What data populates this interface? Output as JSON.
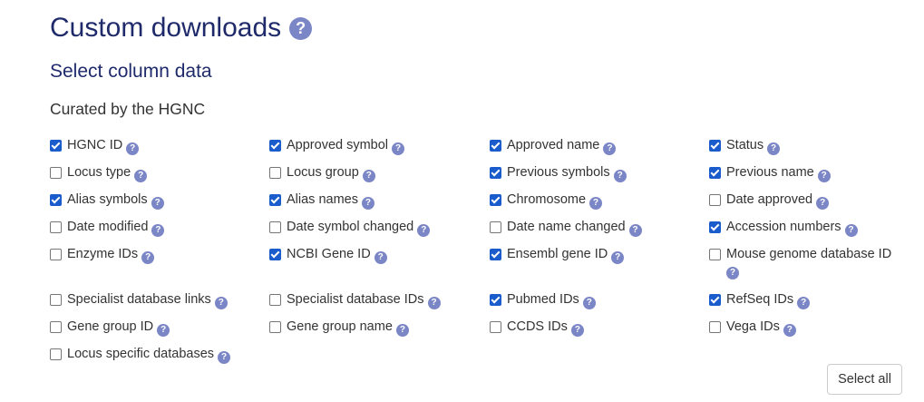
{
  "header": {
    "title": "Custom downloads",
    "help_icon": "question-circle-icon",
    "subtitle": "Select column data",
    "section": "Curated by the HGNC"
  },
  "options": [
    {
      "label": "HGNC ID",
      "checked": true
    },
    {
      "label": "Approved symbol",
      "checked": true
    },
    {
      "label": "Approved name",
      "checked": true
    },
    {
      "label": "Status",
      "checked": true
    },
    {
      "label": "Locus type",
      "checked": false
    },
    {
      "label": "Locus group",
      "checked": false
    },
    {
      "label": "Previous symbols",
      "checked": true
    },
    {
      "label": "Previous name",
      "checked": true
    },
    {
      "label": "Alias symbols",
      "checked": true
    },
    {
      "label": "Alias names",
      "checked": true
    },
    {
      "label": "Chromosome",
      "checked": true
    },
    {
      "label": "Date approved",
      "checked": false
    },
    {
      "label": "Date modified",
      "checked": false
    },
    {
      "label": "Date symbol changed",
      "checked": false
    },
    {
      "label": "Date name changed",
      "checked": false
    },
    {
      "label": "Accession numbers",
      "checked": true
    },
    {
      "label": "Enzyme IDs",
      "checked": false
    },
    {
      "label": "NCBI Gene ID",
      "checked": true
    },
    {
      "label": "Ensembl gene ID",
      "checked": true
    },
    {
      "label": "Mouse genome database ID",
      "checked": false
    },
    {
      "label": "Specialist database links",
      "checked": false
    },
    {
      "label": "Specialist database IDs",
      "checked": false
    },
    {
      "label": "Pubmed IDs",
      "checked": true
    },
    {
      "label": "RefSeq IDs",
      "checked": true
    },
    {
      "label": "Gene group ID",
      "checked": false
    },
    {
      "label": "Gene group name",
      "checked": false
    },
    {
      "label": "CCDS IDs",
      "checked": false
    },
    {
      "label": "Vega IDs",
      "checked": false
    },
    {
      "label": "Locus specific databases",
      "checked": false
    }
  ],
  "select_all_label": "Select all",
  "help_glyph": "?",
  "colors": {
    "heading": "#1f2a6b",
    "help_icon": "#7b86c6",
    "checkbox_checked": "#1a5ccc"
  }
}
